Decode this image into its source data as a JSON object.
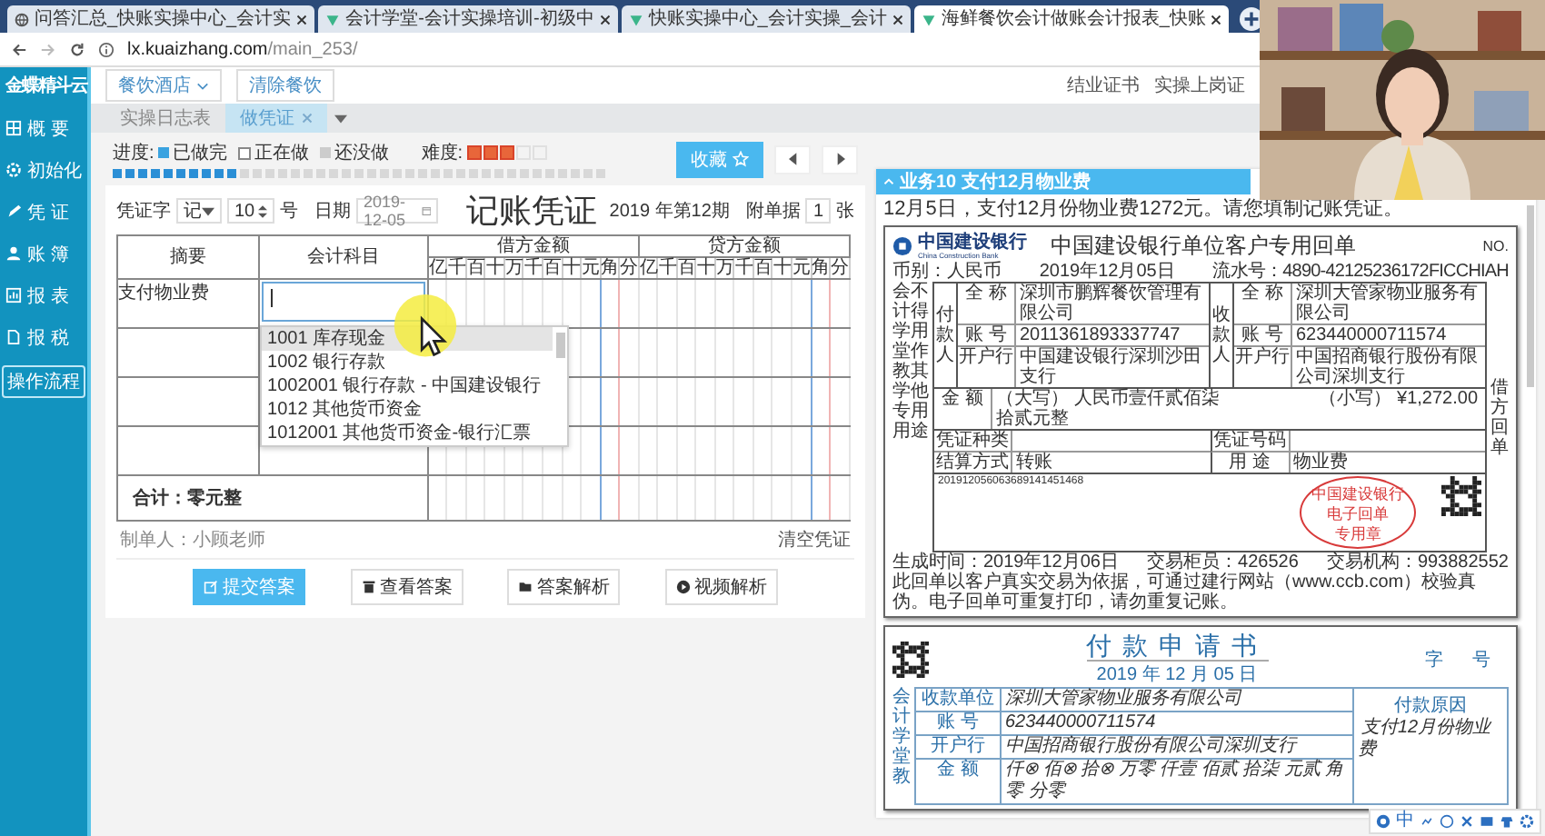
{
  "browser": {
    "tabs": [
      {
        "title": "问答汇总_快账实操中心_会计实",
        "selected": false
      },
      {
        "title": "会计学堂-会计实操培训-初级中",
        "selected": false
      },
      {
        "title": "快账实操中心_会计实操_会计",
        "selected": false
      },
      {
        "title": "海鲜餐饮会计做账会计报表_快账",
        "selected": true
      }
    ],
    "url_host": "lx.kuaizhang.com",
    "url_path": "/main_253/"
  },
  "sidebar": {
    "logo": "金蝶精斗云",
    "items": [
      "概 要",
      "初始化",
      "凭 证",
      "账 簿",
      "报 表",
      "报 税"
    ],
    "flow_button": "操作流程"
  },
  "topbar": {
    "industry": "餐饮酒店",
    "clear": "清除餐饮",
    "links": [
      "结业证书",
      "实操上岗证"
    ]
  },
  "page_tabs": [
    {
      "label": "实操日志表",
      "selected": false,
      "closable": false
    },
    {
      "label": "做凭证",
      "selected": true,
      "closable": true
    }
  ],
  "progress": {
    "label": "进度:",
    "legend": [
      "已做完",
      "正在做",
      "还没做"
    ],
    "difficulty_label": "难度:",
    "stars": 3,
    "level": 0.25,
    "favorite": "收藏"
  },
  "voucher": {
    "word_label": "凭证字",
    "word": "记",
    "number": "10",
    "number_suffix": "号",
    "date_label": "日期",
    "date": "2019-12-05",
    "title": "记账凭证",
    "period": "2019 年第12期",
    "attach_label": "附单据",
    "attachments": "1",
    "attach_suffix": "张",
    "columns": [
      {
        "label": "摘要"
      },
      {
        "label": "会计科目"
      },
      {
        "label": "借方金额",
        "digits": [
          "亿",
          "千",
          "百",
          "十",
          "万",
          "千",
          "百",
          "十",
          "元",
          "角",
          "分"
        ]
      },
      {
        "label": "贷方金额",
        "digits": [
          "亿",
          "千",
          "百",
          "十",
          "万",
          "千",
          "百",
          "十",
          "元",
          "角",
          "分"
        ]
      }
    ],
    "rows": [
      {
        "summary": "支付物业费",
        "editing": true
      },
      {
        "editing": false
      },
      {
        "editing": false
      },
      {
        "editing": false
      }
    ],
    "suggestions": [
      {
        "text": "1001 库存现金",
        "selected": true
      },
      {
        "text": "1002 银行存款",
        "selected": false
      },
      {
        "text": "1002001 银行存款 - 中国建设银行",
        "selected": false
      },
      {
        "text": "1012 其他货币资金",
        "selected": false
      },
      {
        "text": "1012001 其他货币资金-银行汇票",
        "selected": false
      }
    ],
    "total": "合计：零元整",
    "maker": "制单人：小顾老师",
    "clear": "清空凭证"
  },
  "actions": [
    {
      "label": "提交答案",
      "kind": "primary"
    },
    {
      "label": "查看答案",
      "kind": "default"
    },
    {
      "label": "答案解析",
      "kind": "default"
    },
    {
      "label": "视频解析",
      "kind": "default"
    }
  ],
  "task": {
    "title": "业务10 支付12月物业费",
    "text": "12月5日，支付12月份物业费1272元。请您填制记账凭证。"
  },
  "receipt": {
    "bank_name": "中国建设银行",
    "bank_name_en": "China Construction Bank",
    "title": "中国建设银行单位客户专用回单",
    "no_label": "NO.",
    "currency": "币别：人民币",
    "date": "2019年12月05日",
    "serial": "流水号：4890-42125236172FICCHIAH",
    "parties": [
      {
        "role": "付款人",
        "fields": [
          {
            "label": "全 称",
            "value": "深圳市鹏辉餐饮管理有限公司"
          },
          {
            "label": "账 号",
            "value": "2011361893337747"
          },
          {
            "label": "开户行",
            "value": "中国建设银行深圳沙田支行"
          }
        ]
      },
      {
        "role": "收款人",
        "fields": [
          {
            "label": "全 称",
            "value": "深圳大管家物业服务有限公司"
          },
          {
            "label": "账 号",
            "value": "623440000711574"
          },
          {
            "label": "开户行",
            "value": "中国招商银行股份有限公司深圳支行"
          }
        ]
      }
    ],
    "amount_label": "金 额",
    "amount_words": "（大写） 人民币壹仟贰佰柒拾贰元整",
    "amount_figures": "（小写） ¥1,272.00",
    "details": [
      {
        "label": "凭证种类"
      },
      {
        "label": "凭证号码"
      },
      {
        "label": "结算方式",
        "value": "转账"
      },
      {
        "label": "用 途",
        "value": "物业费"
      }
    ],
    "reference": "201912056063689141451468",
    "stamp": [
      "中国建设银行",
      "电子回单",
      "专用章"
    ],
    "side_notes": [
      "会计学堂教学专用",
      "不得用作其他用途"
    ],
    "copy_label": "借方回单",
    "footer": [
      "生成时间：2019年12月06日",
      "交易柜员：426526",
      "交易机构：993882552"
    ],
    "notice": "此回单以客户真实交易为依据，可通过建行网站（www.ccb.com）校验真伪。电子回单可重复打印，请勿重复记账。"
  },
  "payment_request": {
    "title": "付款申请书",
    "date": "2019 年 12 月 05 日",
    "word_label": "字",
    "number_label": "号",
    "fields": [
      {
        "label": "收款单位",
        "value": "深圳大管家物业服务有限公司"
      },
      {
        "label": "账 号",
        "value": "623440000711574"
      },
      {
        "label": "开户行",
        "value": "中国招商银行股份有限公司深圳支行"
      },
      {
        "label": "金 额",
        "value": "仟⊗ 佰⊗ 拾⊗ 万零 仟壹 佰贰 拾柒 元贰 角零 分零"
      }
    ],
    "reason_label": "付款原因",
    "reason": "支付12月份物业费",
    "side_note": "会计学堂教"
  },
  "tray": {
    "ime": "中"
  }
}
